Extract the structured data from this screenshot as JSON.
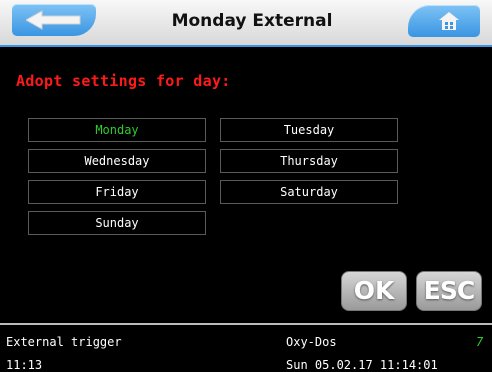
{
  "header": {
    "title": "Monday External"
  },
  "content": {
    "heading": "Adopt settings for day:",
    "days": [
      {
        "label": "Monday",
        "selected": true
      },
      {
        "label": "Tuesday",
        "selected": false
      },
      {
        "label": "Wednesday",
        "selected": false
      },
      {
        "label": "Thursday",
        "selected": false
      },
      {
        "label": "Friday",
        "selected": false
      },
      {
        "label": "Saturday",
        "selected": false
      },
      {
        "label": "Sunday",
        "selected": false
      }
    ],
    "ok_label": "OK",
    "esc_label": "ESC"
  },
  "footer": {
    "left_top": "External trigger",
    "left_bottom": "11:13",
    "right_top": "Oxy-Dos",
    "right_number": "7",
    "right_bottom": "Sun 05.02.17 11:14:01"
  },
  "colors": {
    "heading": "#ff1a1a",
    "selected": "#2ecc2e",
    "accent": "#3a95e2"
  },
  "icons": {
    "back": "arrow-left-icon",
    "home": "home-icon"
  }
}
